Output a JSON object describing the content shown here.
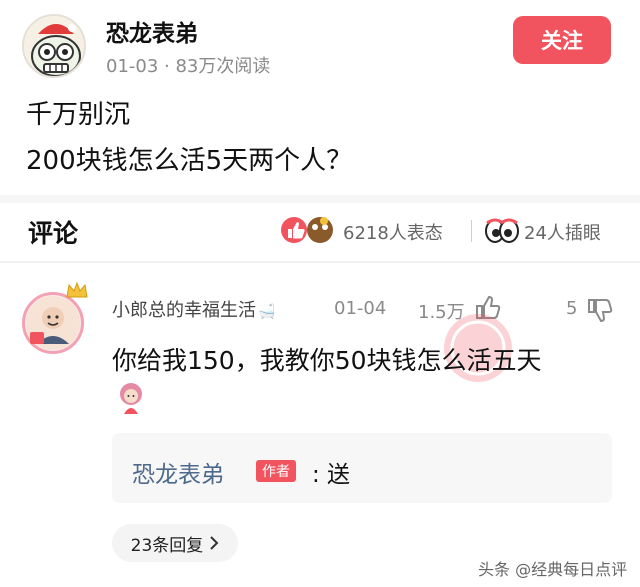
{
  "post": {
    "author_name": "恐龙表弟",
    "meta": "01-03 · 83万次阅读",
    "follow_label": "关注",
    "text_line1": "千万别沉",
    "text_line2": "200块钱怎么活5天两个人？"
  },
  "comments_header": {
    "title": "评论",
    "reactions_count": "6218人表态",
    "stickers_count": "24人插眼",
    "icons": [
      "thumbs-up-icon",
      "heart-icon",
      "emoji-icon",
      "eyes-icon"
    ]
  },
  "comment": {
    "user_name": "小郎总的幸福生活",
    "date": "01-04",
    "likes": "1.5万",
    "reply_count": "5",
    "text": "你给我150，我教你50块钱怎么活五天",
    "reply": {
      "author": "恐龙表弟",
      "badge": "作者",
      "text": ": 送"
    },
    "more_replies_label": "23条回复",
    "more_replies_icon": "chevron-right-icon"
  },
  "watermark": "头条 @经典每日点评",
  "colors": {
    "accent": "#f1545f",
    "link": "#4e6a8a",
    "muted": "#8a8a8a"
  }
}
